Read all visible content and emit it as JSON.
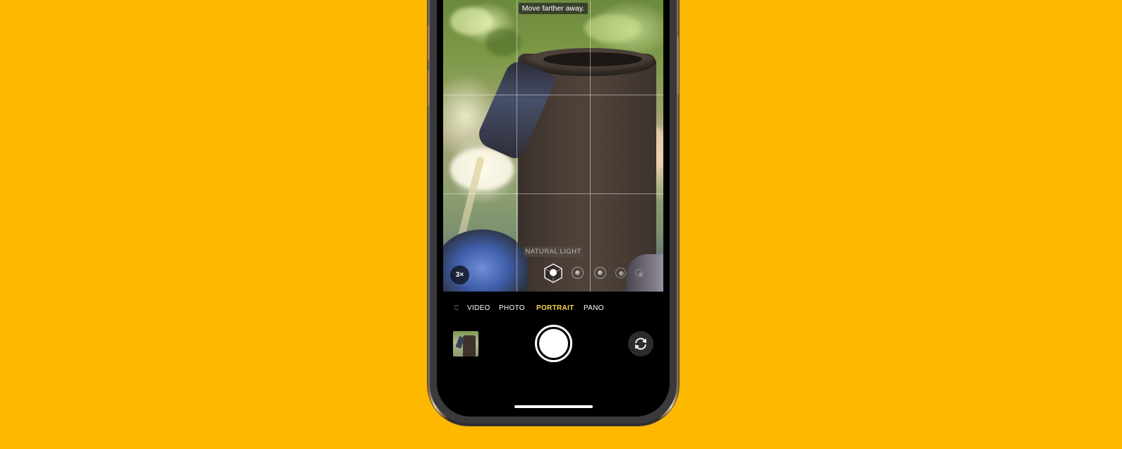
{
  "app": "Camera",
  "viewfinder": {
    "hint": "Move farther away.",
    "lighting_label": "NATURAL LIGHT",
    "zoom_level": "3×",
    "lighting_options": [
      {
        "name": "natural-light",
        "selected": true
      },
      {
        "name": "studio-light",
        "selected": false
      },
      {
        "name": "contour-light",
        "selected": false
      },
      {
        "name": "stage-light",
        "selected": false
      },
      {
        "name": "stage-light-mono",
        "selected": false
      }
    ]
  },
  "modes": {
    "items": [
      {
        "label": "IC",
        "state": "faded"
      },
      {
        "label": "VIDEO",
        "state": "normal"
      },
      {
        "label": "PHOTO",
        "state": "normal"
      },
      {
        "label": "PORTRAIT",
        "state": "active"
      },
      {
        "label": "PANO",
        "state": "normal"
      }
    ]
  },
  "controls": {
    "thumbnail": "last-photo-thumbnail",
    "shutter": "shutter-button",
    "flip": "flip-camera-icon"
  },
  "colors": {
    "background": "#FFB800",
    "active_mode": "#F6D64A"
  }
}
